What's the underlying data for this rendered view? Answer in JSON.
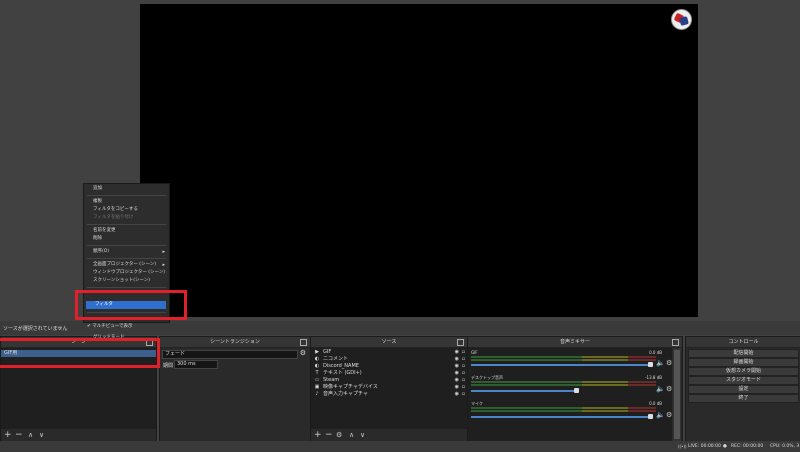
{
  "ui": {
    "accent": "#3d5f8d",
    "highlight": "#2f6fd0",
    "annotation": "#e0202a"
  },
  "status_line": "ソースが選択されていません",
  "scenes": {
    "title": "シーン",
    "items": [
      "GIF用"
    ],
    "footer": [
      "+",
      "−",
      "∧",
      "∨"
    ]
  },
  "transitions": {
    "title": "シーントランジション",
    "type": "フェード",
    "duration_label": "期間",
    "duration": "300 ms"
  },
  "sources": {
    "title": "ソース",
    "items": [
      {
        "icon": "▶",
        "label": "GIF"
      },
      {
        "icon": "◐",
        "label": "ニコメント"
      },
      {
        "icon": "◐",
        "label": "Discord_NAME"
      },
      {
        "icon": "T",
        "label": "テキスト (GDI+)"
      },
      {
        "icon": "▭",
        "label": "Steam"
      },
      {
        "icon": "▣",
        "label": "映像キャプチャデバイス"
      },
      {
        "icon": "♪",
        "label": "音声入力キャプチャ"
      }
    ],
    "footer": [
      "+",
      "−",
      "⚙",
      "∧",
      "∨"
    ]
  },
  "mixer": {
    "title": "音声ミキサー",
    "channels": [
      {
        "name": "GIF",
        "db": "0.0 dB",
        "level": 1.0
      },
      {
        "name": "デスクトップ音声",
        "db": "-13.8 dB",
        "level": 0.58
      },
      {
        "name": "マイク",
        "db": "0.0 dB",
        "level": 1.0
      }
    ]
  },
  "controls": {
    "title": "コントロール",
    "buttons": [
      "配信開始",
      "録画開始",
      "仮想カメラ開始",
      "スタジオモード",
      "設定",
      "終了"
    ]
  },
  "statusbar": {
    "live": "LIVE: 00:00:00",
    "rec": "REC: 00:00:00",
    "cpu": "CPU: 0.0%, 3"
  },
  "context_menu": {
    "items": [
      {
        "label": "追加",
        "disabled": false
      },
      {
        "label": "複製",
        "disabled": false
      },
      {
        "label": "フィルタをコピーする",
        "disabled": false
      },
      {
        "label": "フィルタを貼り付け",
        "disabled": true
      },
      {
        "label": "名前を変更",
        "disabled": false
      },
      {
        "label": "削除",
        "disabled": false
      },
      {
        "label": "順序(O)",
        "disabled": false,
        "submenu": true
      },
      {
        "label": "全画面プロジェクター (シーン)",
        "disabled": false,
        "submenu": true
      },
      {
        "label": "ウィンドウプロジェクター (シーン)",
        "disabled": false
      },
      {
        "label": "スクリーンショット(シーン)",
        "disabled": false
      },
      {
        "label": "フィルタ",
        "disabled": false,
        "highlighted": true
      },
      {
        "label": "マルチビューで表示",
        "disabled": false,
        "checked": true
      },
      {
        "label": "グリッドモード",
        "disabled": false
      }
    ],
    "submenu_arrow": "▸",
    "check": "✔"
  }
}
